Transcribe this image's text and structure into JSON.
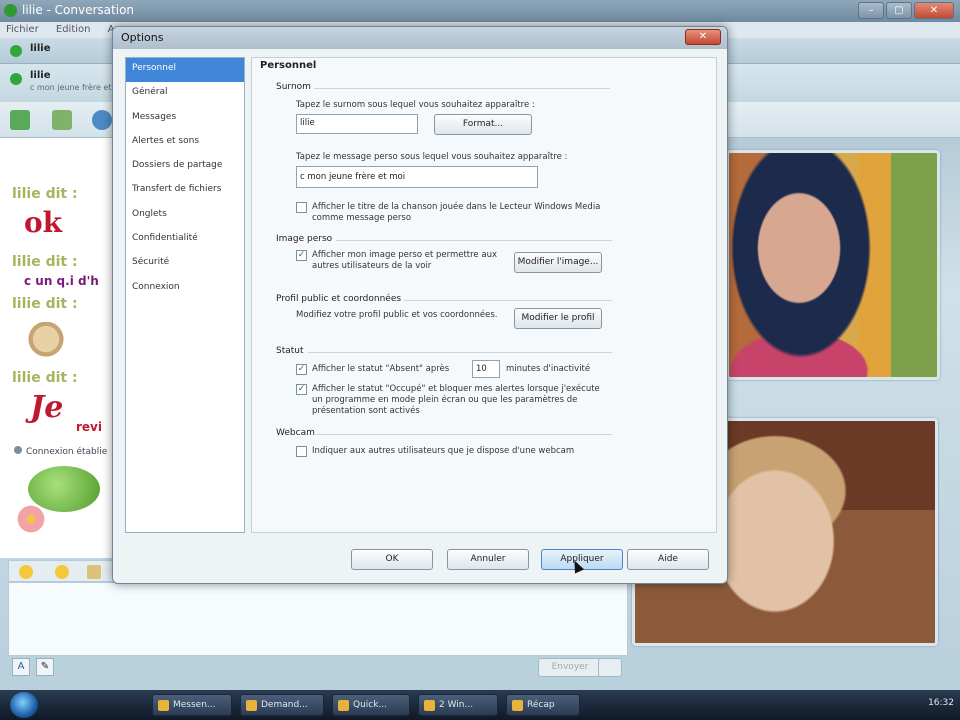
{
  "main_window": {
    "title": "lilie - Conversation",
    "menu": [
      "Fichier",
      "Edition",
      "Ac"
    ],
    "contact_bar_name": "lilie",
    "contact_name": "lilie",
    "contact_psm": "c mon jeune frère et moi",
    "messages": [
      {
        "author": "lilie dit :",
        "text": "ok",
        "color": "#c0182e"
      },
      {
        "author": "lilie dit :",
        "text": "c un q.i d'h",
        "color": "#7a1a7a"
      },
      {
        "author": "lilie dit :",
        "text": "",
        "color": "#000000"
      },
      {
        "author": "lilie dit :",
        "text": "Je",
        "color": "#c0182e"
      }
    ],
    "trailing_text": "revi",
    "connection_status": "Connexion établie",
    "send_label": "Envoyer"
  },
  "dialog": {
    "title": "Options",
    "close_label": "✕",
    "nav_items": [
      "Personnel",
      "Général",
      "Messages",
      "Alertes et sons",
      "Dossiers de partage",
      "Transfert de fichiers",
      "Onglets",
      "Confidentialité",
      "Sécurité",
      "Connexion"
    ],
    "active_nav": "Personnel",
    "section_title": "Personnel",
    "surnom": {
      "label": "Surnom",
      "instruction": "Tapez le surnom sous lequel vous souhaitez apparaître :",
      "value": "lilie",
      "format_button": "Format..."
    },
    "psm": {
      "instruction": "Tapez le message perso sous lequel vous souhaitez apparaître :",
      "value": "c mon jeune frère et moi",
      "media_checkbox_label_1": "Afficher le titre de la chanson jouée dans le Lecteur Windows Media",
      "media_checkbox_label_2": "comme message perso",
      "media_checked": false
    },
    "image_perso": {
      "label": "Image perso",
      "checkbox_label_1": "Afficher mon image perso et permettre aux",
      "checkbox_label_2": "autres utilisateurs de la voir",
      "checked": true,
      "button": "Modifier l'image..."
    },
    "profil": {
      "label": "Profil public et coordonnées",
      "instruction": "Modifiez votre profil public et vos coordonnées.",
      "button": "Modifier le profil"
    },
    "statut": {
      "label": "Statut",
      "away_label_pre": "Afficher le statut \"Absent\" après",
      "away_minutes": "10",
      "away_label_post": "minutes d'inactivité",
      "away_checked": true,
      "busy_label_1": "Afficher le statut \"Occupé\" et bloquer mes alertes lorsque j'exécute",
      "busy_label_2": "un programme en mode plein écran ou que les paramètres de",
      "busy_label_3": "présentation sont activés",
      "busy_checked": true
    },
    "webcam": {
      "label": "Webcam",
      "checkbox_label": "Indiquer aux autres utilisateurs que je dispose d'une webcam",
      "checked": false
    },
    "buttons": {
      "ok": "OK",
      "cancel": "Annuler",
      "apply": "Appliquer",
      "help": "Aide"
    }
  },
  "taskbar": {
    "items": [
      "Messen...",
      "Demand...",
      "Quick...",
      "2 Win...",
      "Récap"
    ],
    "clock": "16:32"
  },
  "icons": {
    "app": "messenger-icon",
    "close": "close-icon"
  },
  "colors": {
    "accent": "#3f86d8",
    "online": "#2fa83a"
  }
}
